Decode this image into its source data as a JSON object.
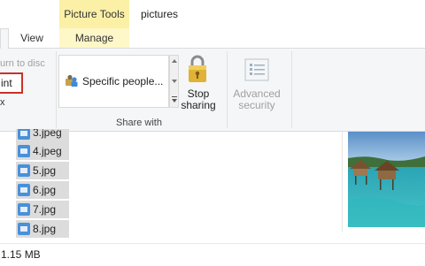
{
  "title": {
    "context_group": "Picture Tools",
    "window_title": "pictures"
  },
  "tabs": [
    {
      "label": "View"
    },
    {
      "label": "Manage"
    }
  ],
  "ribbon": {
    "burn_to_disc": "urn to disc",
    "print": "int",
    "fax": "x",
    "share_list_item": "Specific people...",
    "stop_sharing_line1": "Stop",
    "stop_sharing_line2": "sharing",
    "advanced_security_line1": "Advanced",
    "advanced_security_line2": "security",
    "group_share_with": "Share with"
  },
  "files": [
    {
      "name": "3.jpeg"
    },
    {
      "name": "4.jpeg"
    },
    {
      "name": "5.jpg"
    },
    {
      "name": "6.jpg"
    },
    {
      "name": "7.jpg"
    },
    {
      "name": "8.jpg"
    }
  ],
  "status": {
    "size": "1.15 MB"
  },
  "colors": {
    "context_tab_bg": "#fbf0a6",
    "print_highlight": "#c9312a",
    "file_selected_bg": "#dcdcdc"
  },
  "icons": {
    "share": "people-icon",
    "stop_sharing": "padlock-icon",
    "advanced_security": "security-doc-icon",
    "file": "jpg-file-icon"
  }
}
